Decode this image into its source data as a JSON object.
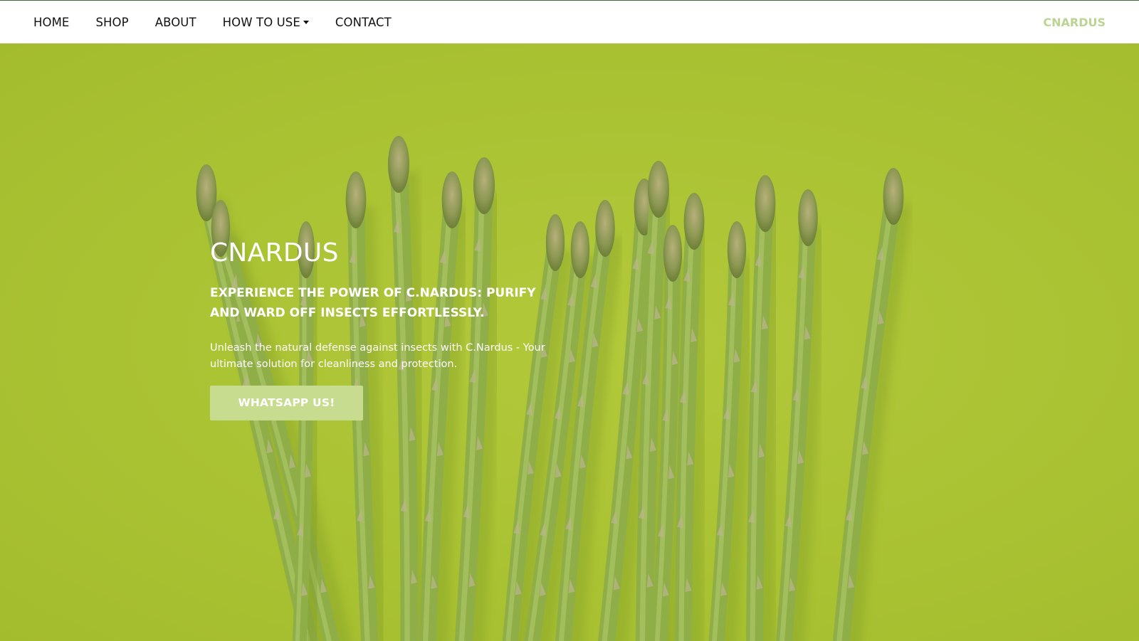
{
  "nav": {
    "items": [
      {
        "label": "HOME"
      },
      {
        "label": "SHOP"
      },
      {
        "label": "ABOUT"
      },
      {
        "label": "HOW TO USE",
        "has_dropdown": true
      },
      {
        "label": "CONTACT"
      }
    ],
    "brand": "CNARDUS"
  },
  "hero": {
    "title": "CNARDUS",
    "subtitle": "EXPERIENCE THE POWER OF C.NARDUS: PURIFY AND WARD OFF INSECTS EFFORTLESSLY.",
    "text": "Unleash the natural defense against insects with C.Nardus - Your ultimate solution for cleanliness and protection.",
    "cta_label": "WHATSAPP US!",
    "background_image": "asparagus-spears-on-lime-green-background"
  },
  "colors": {
    "brand_accent": "#bcd392",
    "hero_background": "#abc334",
    "cta_background": "#c7dc8e",
    "nav_text": "#111111",
    "asparagus_stalk": "#8bab43"
  },
  "icons": {
    "dropdown": "caret-down-icon"
  }
}
